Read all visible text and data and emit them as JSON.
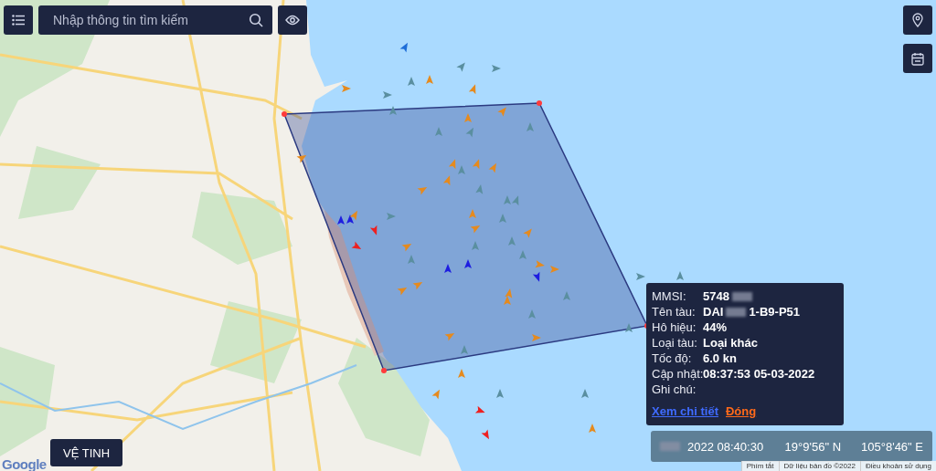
{
  "search": {
    "placeholder": "Nhập thông tin tìm kiếm"
  },
  "info_panel": {
    "rows": [
      {
        "label": "MMSI:",
        "value": "5748",
        "blurred_tail": true
      },
      {
        "label": "Tên tàu:",
        "value": "DAI",
        "blurred_tail": true,
        "suffix": "1-B9-P51"
      },
      {
        "label": "Hô hiệu:",
        "value": "44%",
        "blurred_tail": false
      },
      {
        "label": "Loại tàu:",
        "value": "Loại khác",
        "blurred_tail": false
      },
      {
        "label": "Tốc độ:",
        "value": "6.0 kn",
        "blurred_tail": false
      },
      {
        "label": "Cập nhật:",
        "value": "08:37:53 05-03-2022",
        "blurred_tail": false
      },
      {
        "label": "Ghi chú:",
        "value": "",
        "blurred_tail": false
      }
    ],
    "links": [
      {
        "label": "Xem chi tiết",
        "kind": "detail"
      },
      {
        "label": "Đóng",
        "kind": "close"
      }
    ]
  },
  "map_type_button": "VỆ TINH",
  "coordinates": {
    "time": "2022 08:40:30",
    "latitude": "19°9'56\" N",
    "longitude": "105°8'46\" E"
  },
  "logo": "Google",
  "attribution": [
    "Phím tắt",
    "Dữ liệu bản đồ ©2022",
    "Điều khoản sử dụng"
  ]
}
